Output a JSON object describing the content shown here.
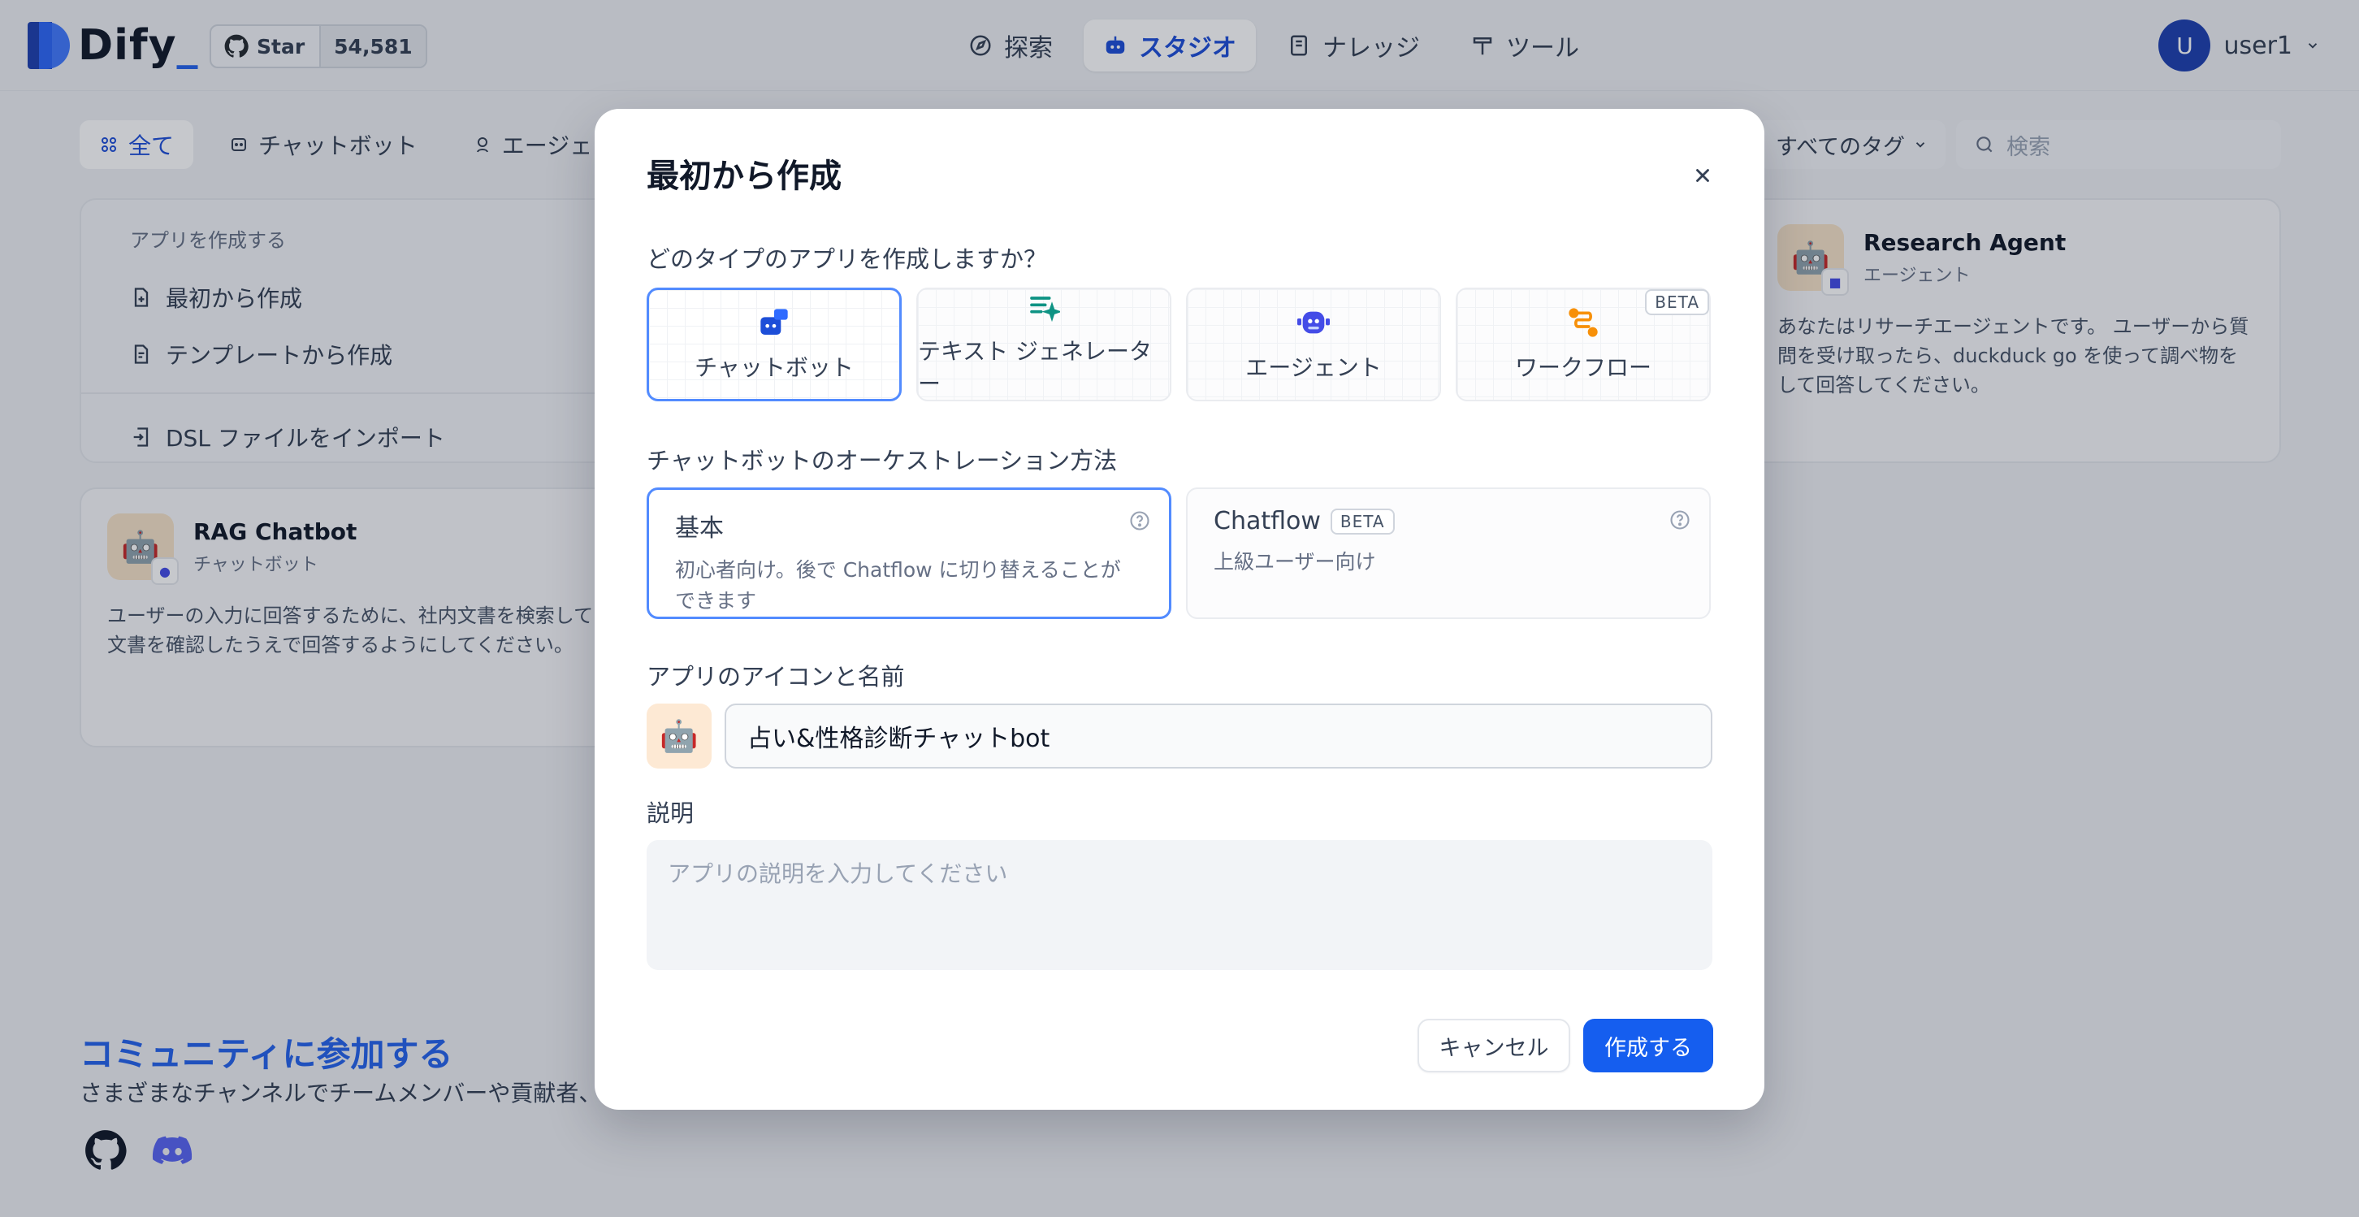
{
  "header": {
    "logo_text": "Dify",
    "star_label": "Star",
    "star_count": "54,581",
    "nav": [
      {
        "label": "探索"
      },
      {
        "label": "スタジオ"
      },
      {
        "label": "ナレッジ"
      },
      {
        "label": "ツール"
      }
    ],
    "user": {
      "initial": "U",
      "name": "user1"
    }
  },
  "filters": {
    "tabs": [
      {
        "label": "全て"
      },
      {
        "label": "チャットボット"
      },
      {
        "label": "エージェント"
      }
    ],
    "tag_select": "すべてのタグ",
    "search_placeholder": "検索"
  },
  "create_card": {
    "title": "アプリを作成する",
    "from_scratch": "最初から作成",
    "from_template": "テンプレートから作成",
    "import_dsl": "DSL ファイルをインポート"
  },
  "apps": [
    {
      "name": "RAG Chatbot",
      "type": "チャットボット",
      "description": "ユーザーの入力に回答するために、社内文書を検索して関連する文書を確認したうえで回答するようにしてください。"
    },
    {
      "name": "Research Agent",
      "type": "エージェント",
      "description": "あなたはリサーチエージェントです。 ユーザーから質問を受け取ったら、duckduck go を使って調べ物をして回答してください。"
    }
  ],
  "community": {
    "title": "コミュニティに参加する",
    "subtitle": "さまざまなチャンネルでチームメンバーや貢献者、"
  },
  "modal": {
    "title": "最初から作成",
    "type_question": "どのタイプのアプリを作成しますか？",
    "types": [
      {
        "label": "チャットボット"
      },
      {
        "label": "テキスト ジェネレーター"
      },
      {
        "label": "エージェント"
      },
      {
        "label": "ワークフロー",
        "badge": "BETA"
      }
    ],
    "orchestration_label": "チャットボットのオーケストレーション方法",
    "orchestration": [
      {
        "title": "基本",
        "description": "初心者向け。後で Chatflow に切り替えることができます"
      },
      {
        "title": "Chatflow",
        "badge": "BETA",
        "description": "上級ユーザー向け"
      }
    ],
    "icon_name_label": "アプリのアイコンと名前",
    "app_name_value": "占い&性格診断チャットbot",
    "description_label": "説明",
    "description_placeholder": "アプリの説明を入力してください",
    "cancel_label": "キャンセル",
    "create_label": "作成する"
  },
  "colors": {
    "accent": "#155eef",
    "selected_border": "#528bff",
    "brand_blue": "#1d4ed8"
  }
}
